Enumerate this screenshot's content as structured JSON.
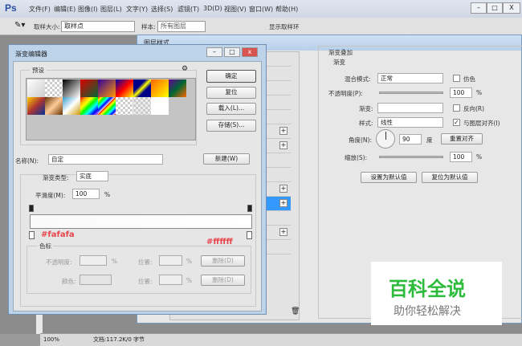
{
  "app": {
    "logo": "Ps",
    "menu": [
      "文件(F)",
      "编辑(E)",
      "图像(I)",
      "图层(L)",
      "文字(Y)",
      "选择(S)",
      "滤镜(T)",
      "3D(D)",
      "视图(V)",
      "窗口(W)",
      "帮助(H)"
    ],
    "win_buttons": [
      "–",
      "□",
      "X"
    ]
  },
  "options": {
    "sample_size_label": "取样大小:",
    "sample_size": "取样点",
    "sample_label": "样本:",
    "sample": "所有图层",
    "show_ring": "显示取样环"
  },
  "status": {
    "zoom": "100%",
    "doc": "文档:117.2K/0 字节"
  },
  "layer_style": {
    "title": "图层样式",
    "section": "渐变叠加",
    "subsection": "渐变",
    "blend_label": "混合模式:",
    "blend": "正常",
    "dither": "仿色",
    "opacity_label": "不透明度(P):",
    "opacity": "100",
    "pct": "%",
    "gradient_label": "渐变:",
    "reverse": "反向(R)",
    "style_label": "样式:",
    "style": "线性",
    "align": "与图层对齐(I)",
    "angle_label": "角度(N):",
    "angle": "90",
    "deg": "度",
    "reset_align": "重置对齐",
    "scale_label": "缩放(S):",
    "scale": "100",
    "set_default": "设置为默认值",
    "reset_default": "复位为默认值"
  },
  "gradient_editor": {
    "title": "渐变编辑器",
    "presets": "预设",
    "ok": "确定",
    "reset": "复位",
    "load": "载入(L)...",
    "save": "存储(S)...",
    "name_label": "名称(N):",
    "name": "自定",
    "new": "新建(W)",
    "type_label": "渐变类型:",
    "type": "实底",
    "smooth_label": "平滑度(M):",
    "smooth": "100",
    "pct": "%",
    "stops": "色标",
    "opacity_label": "不透明度:",
    "location_label": "位置:",
    "delete": "删除(D)",
    "color_label": "颜色:"
  },
  "annotations": {
    "left": "#fafafa",
    "right": "#ffffff",
    "color": "#e8434b"
  },
  "watermark": {
    "title": "百科全说",
    "subtitle": "助你轻松解决"
  }
}
